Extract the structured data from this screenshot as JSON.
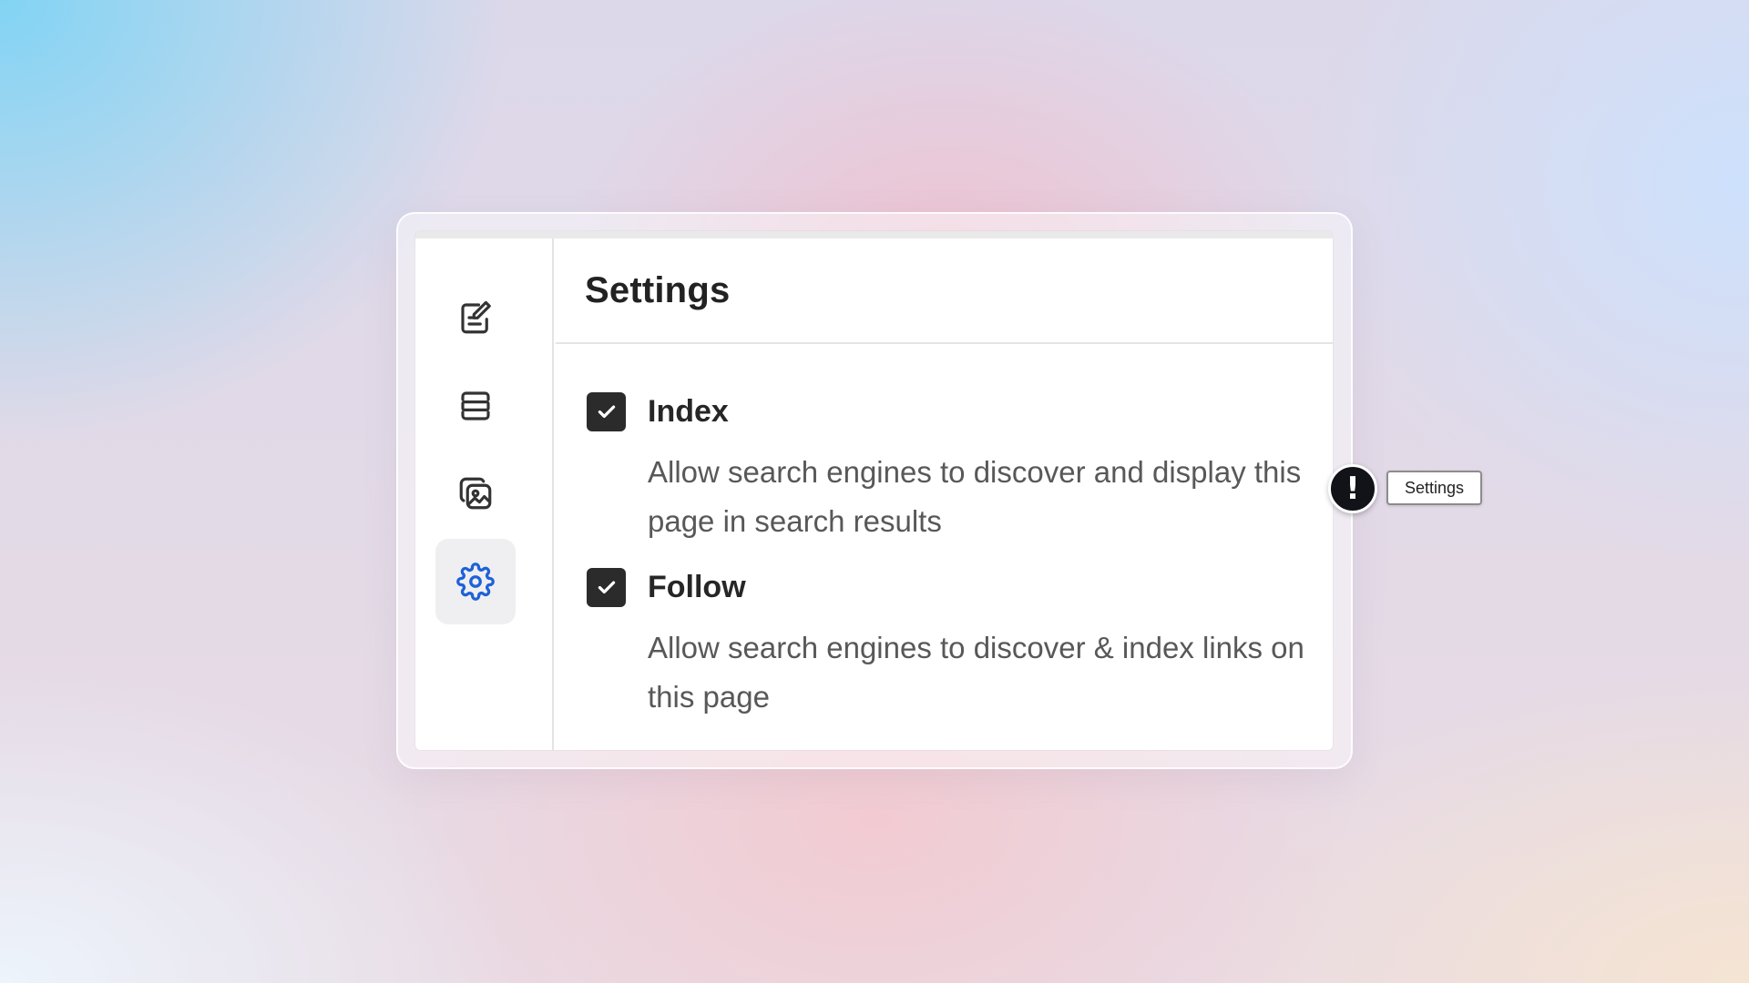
{
  "panel": {
    "title": "Settings"
  },
  "sidebar": {
    "items": [
      {
        "name": "edit",
        "icon": "edit-note-icon",
        "active": false
      },
      {
        "name": "layout",
        "icon": "section-layout-icon",
        "active": false
      },
      {
        "name": "media",
        "icon": "images-icon",
        "active": false
      },
      {
        "name": "settings",
        "icon": "gear-icon",
        "active": true
      }
    ]
  },
  "options": [
    {
      "label": "Index",
      "checked": true,
      "description": "Allow search engines to discover and display this page in search results"
    },
    {
      "label": "Follow",
      "checked": true,
      "description": "Allow search engines to discover & index links on this page"
    }
  ],
  "callout": {
    "symbol": "!",
    "tooltip": "Settings"
  },
  "colors": {
    "accent": "#1e62d8",
    "checkbox": "#2b2b2b",
    "alert": "#111318"
  }
}
